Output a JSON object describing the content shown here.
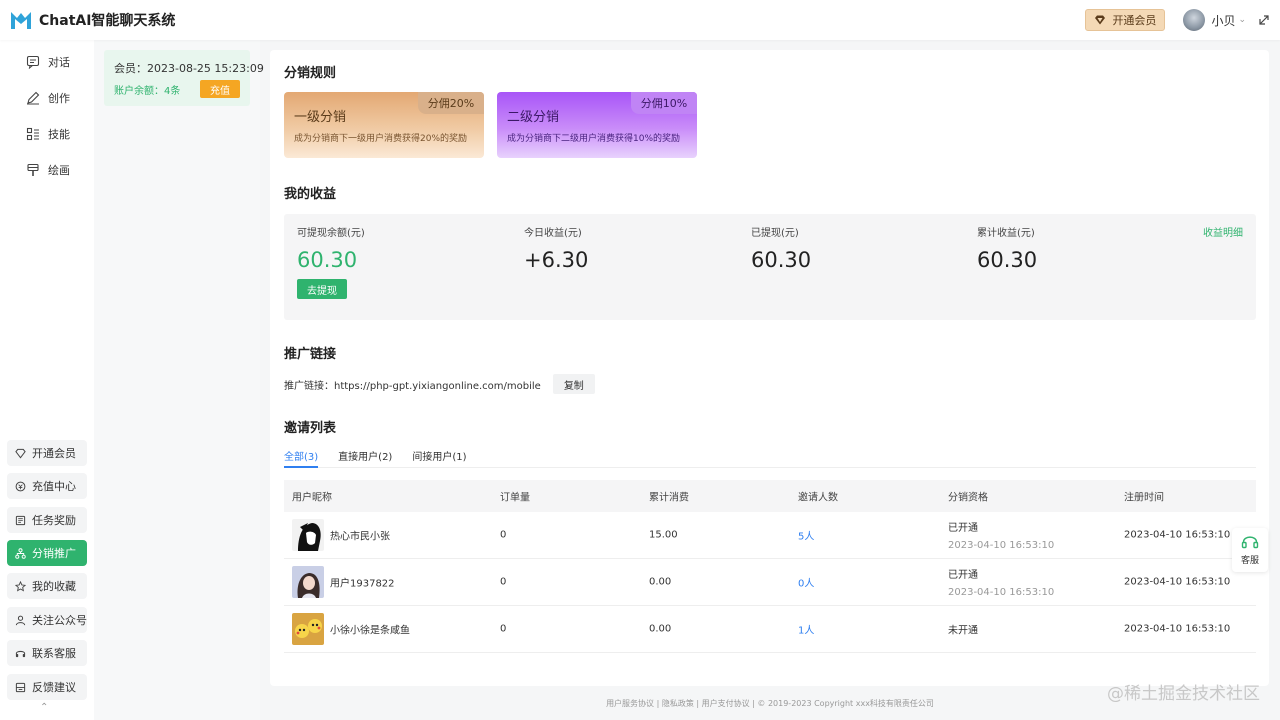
{
  "header": {
    "app_title": "ChatAI智能聊天系统",
    "vip_label": "开通会员",
    "user_name": "小贝"
  },
  "nav": [
    {
      "label": "对话",
      "icon": "chat-icon"
    },
    {
      "label": "创作",
      "icon": "edit-icon"
    },
    {
      "label": "技能",
      "icon": "skill-icon"
    },
    {
      "label": "绘画",
      "icon": "paint-icon"
    }
  ],
  "bottom_nav": [
    {
      "label": "开通会员",
      "icon": "diamond-icon"
    },
    {
      "label": "充值中心",
      "icon": "recharge-icon"
    },
    {
      "label": "任务奖励",
      "icon": "task-icon"
    },
    {
      "label": "分销推广",
      "icon": "distribution-icon",
      "active": true
    },
    {
      "label": "我的收藏",
      "icon": "star-icon"
    },
    {
      "label": "关注公众号",
      "icon": "user-icon"
    },
    {
      "label": "联系客服",
      "icon": "headset-icon"
    },
    {
      "label": "反馈建议",
      "icon": "feedback-icon"
    }
  ],
  "member": {
    "line": "会员：2023-08-25 15:23:09",
    "balance": "账户余额：4条",
    "recharge_label": "充值"
  },
  "rules": {
    "title": "分销规则",
    "level1": {
      "name": "一级分销",
      "badge": "分佣20%",
      "desc": "成为分销商下一级用户消费获得20%的奖励"
    },
    "level2": {
      "name": "二级分销",
      "badge": "分佣10%",
      "desc": "成为分销商下二级用户消费获得10%的奖励"
    }
  },
  "earnings": {
    "title": "我的收益",
    "withdrawable_label": "可提现余额(元)",
    "withdrawable_value": "60.30",
    "today_label": "今日收益(元)",
    "today_value": "+6.30",
    "withdrawn_label": "已提现(元)",
    "withdrawn_value": "60.30",
    "total_label": "累计收益(元)",
    "total_value": "60.30",
    "withdraw_button": "去提现",
    "detail_link": "收益明细"
  },
  "promo": {
    "title": "推广链接",
    "line": "推广链接：https://php-gpt.yixiangonline.com/mobile",
    "copy_label": "复制"
  },
  "invites": {
    "title": "邀请列表",
    "tabs": [
      "全部(3)",
      "直接用户(2)",
      "间接用户(1)"
    ],
    "columns": [
      "用户昵称",
      "订单量",
      "累计消费",
      "邀请人数",
      "分销资格",
      "注册时间"
    ],
    "rows": [
      {
        "nickname": "热心市民小张",
        "orders": "0",
        "spend": "15.00",
        "invited": "5人",
        "status": "已开通",
        "status_time": "2023-04-10 16:53:10",
        "registered": "2023-04-10 16:53:10"
      },
      {
        "nickname": "用户1937822",
        "orders": "0",
        "spend": "0.00",
        "invited": "0人",
        "status": "已开通",
        "status_time": "2023-04-10 16:53:10",
        "registered": "2023-04-10 16:53:10"
      },
      {
        "nickname": "小徐小徐是条咸鱼",
        "orders": "0",
        "spend": "0.00",
        "invited": "1人",
        "status": "未开通",
        "status_time": "",
        "registered": "2023-04-10 16:53:10"
      }
    ]
  },
  "service_label": "客服",
  "footer": "用户服务协议 | 隐私政策 | 用户支付协议 | © 2019-2023 Copyright xxx科技有限责任公司",
  "watermark": "@稀土掘金技术社区"
}
